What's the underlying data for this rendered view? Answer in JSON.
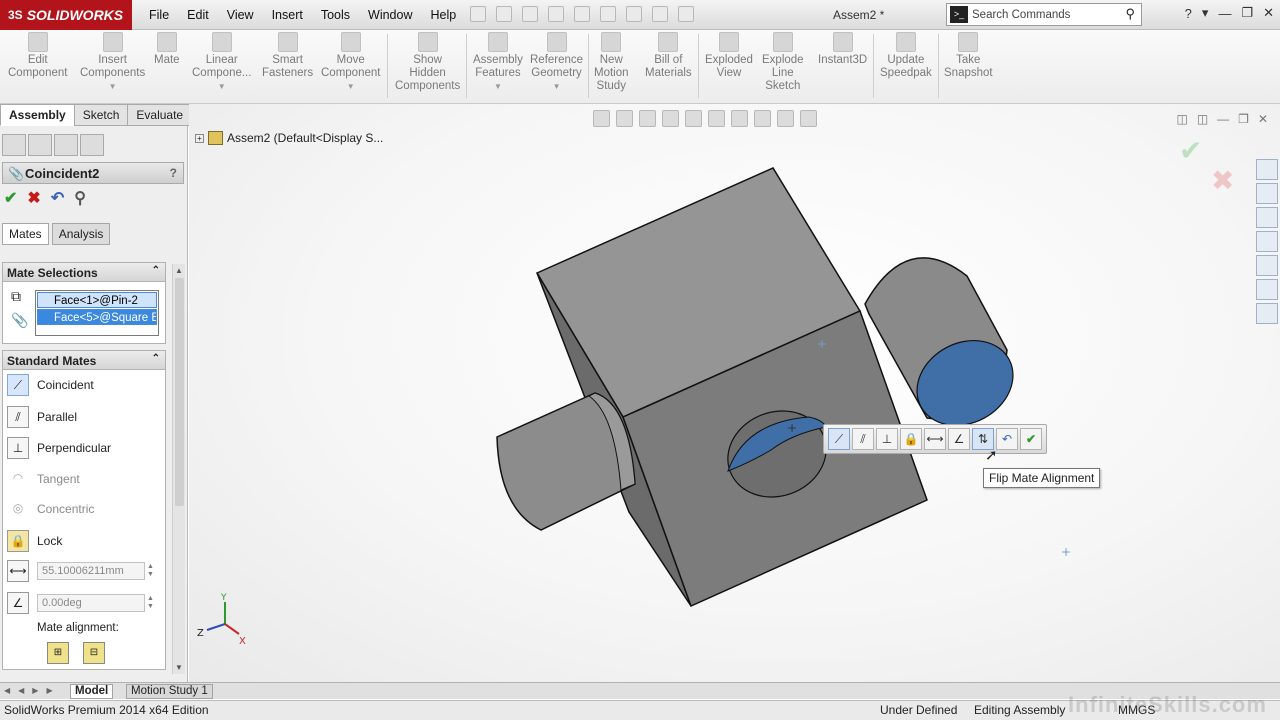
{
  "app": {
    "logo": "SOLIDWORKS",
    "document_title": "Assem2 *"
  },
  "menu": [
    "File",
    "Edit",
    "View",
    "Insert",
    "Tools",
    "Window",
    "Help"
  ],
  "search": {
    "placeholder": "Search Commands"
  },
  "commands": [
    {
      "label": "Edit\nComponent"
    },
    {
      "label": "Insert\nComponents"
    },
    {
      "label": "Mate"
    },
    {
      "label": "Linear\nCompone..."
    },
    {
      "label": "Smart\nFasteners"
    },
    {
      "label": "Move\nComponent"
    },
    {
      "label": "Show\nHidden\nComponents"
    },
    {
      "label": "Assembly\nFeatures"
    },
    {
      "label": "Reference\nGeometry"
    },
    {
      "label": "New\nMotion\nStudy"
    },
    {
      "label": "Bill of\nMaterials"
    },
    {
      "label": "Exploded\nView"
    },
    {
      "label": "Explode\nLine\nSketch"
    },
    {
      "label": "Instant3D"
    },
    {
      "label": "Update\nSpeedpak"
    },
    {
      "label": "Take\nSnapshot"
    }
  ],
  "command_tabs": [
    "Assembly",
    "Sketch",
    "Evaluate"
  ],
  "property_manager": {
    "title": "Coincident2",
    "help": "?",
    "subtabs": [
      "Mates",
      "Analysis"
    ],
    "mate_selections": {
      "header": "Mate Selections",
      "items": [
        "Face<1>@Pin-2",
        "Face<5>@Square Bl"
      ]
    },
    "standard_mates": {
      "header": "Standard Mates",
      "items": [
        "Coincident",
        "Parallel",
        "Perpendicular",
        "Tangent",
        "Concentric",
        "Lock"
      ],
      "distance": "55.10006211mm",
      "angle": "0.00deg",
      "alignment_label": "Mate alignment:"
    }
  },
  "graphics": {
    "tree_root": "Assem2  (Default<Display S...",
    "tooltip": "Flip Mate Alignment",
    "triad": {
      "x": "X",
      "y": "Y",
      "z": "Z"
    },
    "colors": {
      "part_grey": "#888888",
      "selected_face": "#3f6fa6"
    }
  },
  "bottom_tabs": [
    "Model",
    "Motion Study 1"
  ],
  "status": {
    "edition": "SolidWorks Premium 2014 x64 Edition",
    "state": "Under Defined",
    "mode": "Editing Assembly",
    "units": "MMGS",
    "watermark": "InfiniteSkills.com"
  }
}
